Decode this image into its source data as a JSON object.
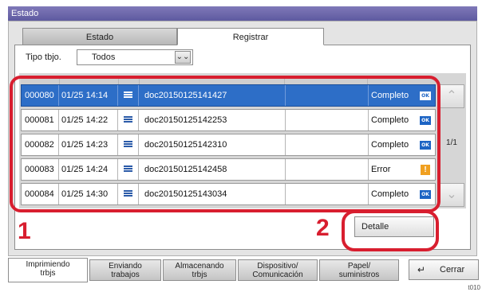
{
  "window": {
    "title": "Estado"
  },
  "tabs": [
    {
      "label": "Estado",
      "active": false
    },
    {
      "label": "Registrar",
      "active": true
    }
  ],
  "filter": {
    "label": "Tipo tbjo.",
    "value": "Todos"
  },
  "jobs": [
    {
      "id": "000080",
      "datetime": "01/25 14:14",
      "name": "doc20150125141427",
      "status": "Completo",
      "status_icon": "ok-icon",
      "selected": true
    },
    {
      "id": "000081",
      "datetime": "01/25 14:22",
      "name": "doc20150125142253",
      "status": "Completo",
      "status_icon": "ok-icon",
      "selected": false
    },
    {
      "id": "000082",
      "datetime": "01/25 14:23",
      "name": "doc20150125142310",
      "status": "Completo",
      "status_icon": "ok-icon",
      "selected": false
    },
    {
      "id": "000083",
      "datetime": "01/25 14:24",
      "name": "doc20150125142458",
      "status": "Error",
      "status_icon": "warning-icon",
      "selected": false
    },
    {
      "id": "000084",
      "datetime": "01/25 14:30",
      "name": "doc20150125143034",
      "status": "Completo",
      "status_icon": "ok-icon",
      "selected": false
    }
  ],
  "pagination": {
    "page": "1/1"
  },
  "callouts": {
    "one": "1",
    "two": "2"
  },
  "detail_button": {
    "label": "Detalle"
  },
  "bottom_tabs": [
    {
      "line1": "Imprimiendo",
      "line2": "trbjs",
      "active": true
    },
    {
      "line1": "Enviando",
      "line2": "trabajos",
      "active": false
    },
    {
      "line1": "Almacenando",
      "line2": "trbjs",
      "active": false
    },
    {
      "line1": "Dispositivo/",
      "line2": "Comunicación",
      "active": false
    },
    {
      "line1": "Papel/",
      "line2": "suministros",
      "active": false
    }
  ],
  "close_button": {
    "label": "Cerrar"
  },
  "figure_code": "t010",
  "colors": {
    "title_bar": "#6a65a8",
    "selection": "#2d6ec7",
    "highlight": "#d81e2f"
  }
}
